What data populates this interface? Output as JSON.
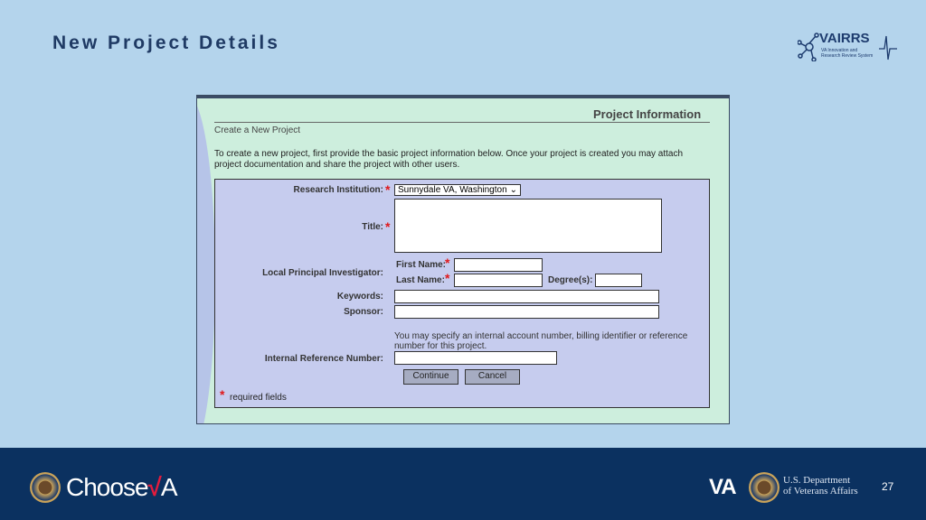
{
  "slide": {
    "title": "New Project Details",
    "page_number": "27"
  },
  "logo": {
    "name": "VAIRRS",
    "tagline_line1": "VA Innovation and",
    "tagline_line2": "Research Review System"
  },
  "screen": {
    "heading": "Project Information",
    "subheading": "Create a New Project",
    "intro_line1": "To create a new project, first provide the basic project information below. Once your project is created you may attach",
    "intro_line2": "project documentation and share the project with other users.",
    "form": {
      "institution_label": "Research Institution:",
      "institution_value": "Sunnydale VA, Washington",
      "title_label": "Title:",
      "pi_label": "Local Principal Investigator:",
      "first_name_label": "First Name:",
      "last_name_label": "Last Name:",
      "degrees_label": "Degree(s):",
      "keywords_label": "Keywords:",
      "sponsor_label": "Sponsor:",
      "ref_help_line1": "You may specify an internal account number, billing identifier or reference",
      "ref_help_line2": "number for this project.",
      "ref_label": "Internal Reference Number:",
      "continue": "Continue",
      "cancel": "Cancel",
      "required_note": "required fields",
      "required_mark": "*"
    }
  },
  "footer": {
    "choose": "Choose",
    "va_mark": "VA",
    "va_big": "VA",
    "dept_line1": "U.S. Department",
    "dept_line2": "of Veterans Affairs"
  }
}
